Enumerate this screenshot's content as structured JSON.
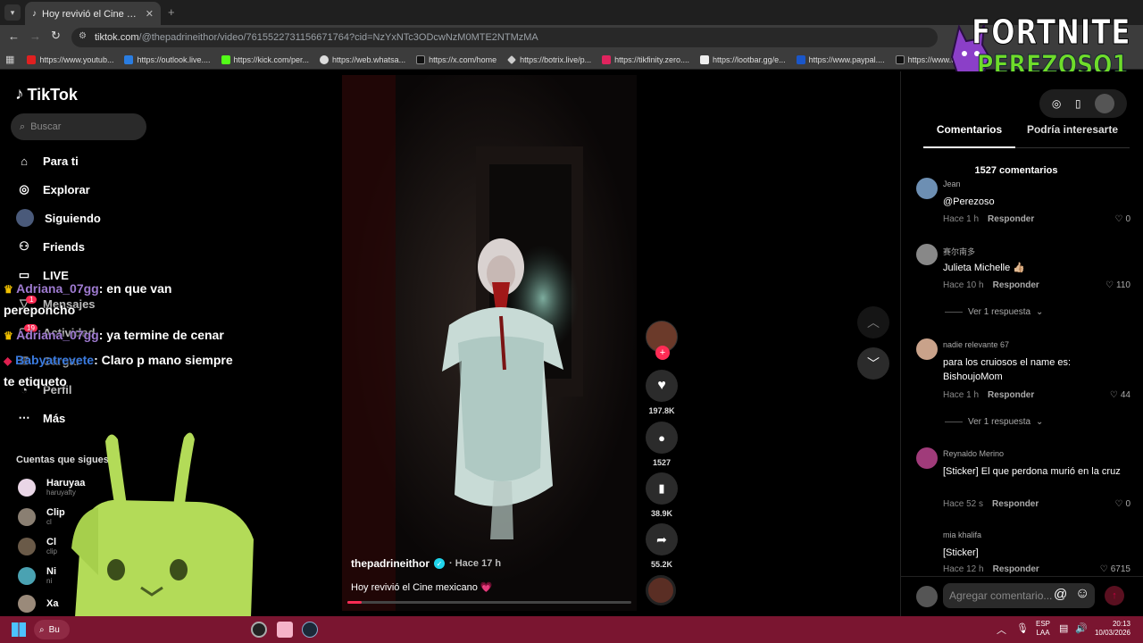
{
  "browser": {
    "tab_title": "Hoy revivió el Cine mexicano 💗",
    "url_host": "tiktok.com",
    "url_path": "/@thepadrineithor/video/7615522731156671764?cid=NzYxNTc3ODcwNzM0MTE2NTMzMA",
    "bookmarks": [
      "https://www.youtub...",
      "https://outlook.live....",
      "https://kick.com/per...",
      "https://web.whatsa...",
      "https://x.com/home",
      "https://botrix.live/p...",
      "https://tikfinity.zero....",
      "https://lootbar.gg/e...",
      "https://www.paypal....",
      "https://www.tiktok.c..."
    ]
  },
  "overlay": {
    "logo_line1": "FORTNITE",
    "logo_line2": "PEREZOSO1"
  },
  "sidebar": {
    "brand": "TikTok",
    "search_placeholder": "Buscar",
    "nav": [
      "Para ti",
      "Explorar",
      "Siguiendo",
      "Friends",
      "LIVE",
      "Mensajes",
      "Actividad",
      "Cargar",
      "Perfil",
      "Más"
    ],
    "nav_badges": {
      "mensajes": "1",
      "actividad": "19"
    },
    "following_title": "Cuentas que sigues",
    "following": [
      {
        "name": "Haruyaa",
        "handle": "haruyafty"
      },
      {
        "name": "Clip",
        "handle": "cl"
      },
      {
        "name": "Cl",
        "handle": "clip"
      },
      {
        "name": "Ni",
        "handle": "ni"
      },
      {
        "name": "Xa",
        "handle": "xa"
      }
    ]
  },
  "chat": [
    {
      "user": "Adriana_07gg",
      "msg": ": en que van",
      "cont": "pereponcho"
    },
    {
      "user": "Adriana_07gg",
      "msg": ": ya termine de cenar",
      "cont": ""
    },
    {
      "user": "Babyatrevete",
      "msg": ": Claro p mano siempre",
      "cont": "te etiqueto"
    }
  ],
  "video": {
    "author": "thepadrineithor",
    "time": "· Hace 17 h",
    "caption": "Hoy revivió el Cine mexicano 💗",
    "progress": 0.05,
    "likes": "197.8K",
    "comments": "1527",
    "saves": "38.9K",
    "shares": "55.2K"
  },
  "panel": {
    "tab_comments": "Comentarios",
    "tab_interest": "Podría interesarte",
    "count": "1527 comentarios",
    "input_placeholder": "Agregar comentario...",
    "reply_label": "Responder",
    "view_replies": "Ver 1 respuesta",
    "comments": [
      {
        "user": "Jean",
        "text": "@Perezoso",
        "time": "Hace 1 h",
        "likes": "0",
        "color": "#6d8fb3"
      },
      {
        "user": "赛尔南多",
        "text": "Julieta Michelle 👍🏼",
        "time": "Hace 10 h",
        "likes": "110",
        "color": "#888"
      },
      {
        "user": "nadie relevante 67",
        "text": "para los cruiosos el name es: BishoujoMom",
        "time": "Hace 1 h",
        "likes": "44",
        "color": "#c9a28a"
      },
      {
        "user": "Reynaldo Merino",
        "text": "[Sticker] El que perdona murió en la cruz",
        "time": "Hace 52 s",
        "likes": "0",
        "color": "#a03b7a"
      },
      {
        "user": "mia khalifa",
        "text": "[Sticker]",
        "time": "Hace 12 h",
        "likes": "6715",
        "color": "#000"
      }
    ]
  },
  "taskbar": {
    "search": "Bu",
    "lang1": "ESP",
    "lang2": "LAA",
    "time": "20:13",
    "date": "10/03/2026"
  }
}
